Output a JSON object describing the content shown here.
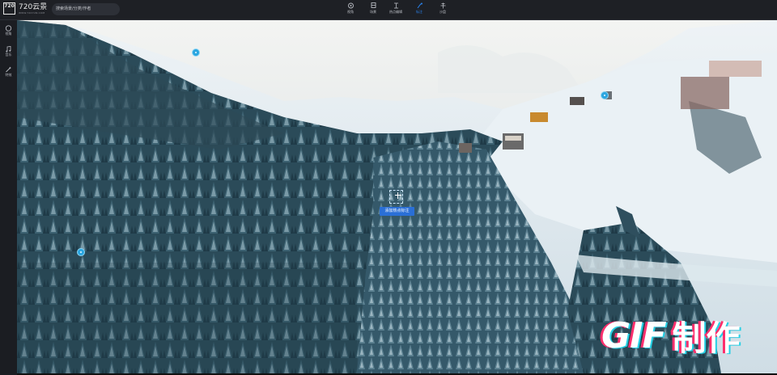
{
  "app": {
    "logo_mark": "720",
    "name": "720云景",
    "subtitle": "WWW.720YUN.COM"
  },
  "search": {
    "placeholder": "搜索场景/分类/作者"
  },
  "toolbar": {
    "items": [
      {
        "icon": "view-icon",
        "label": "视角"
      },
      {
        "icon": "scene-icon",
        "label": "场景"
      },
      {
        "icon": "hotspot-icon",
        "label": "热点编辑"
      },
      {
        "icon": "marker-icon",
        "label": "标注",
        "active": true
      },
      {
        "icon": "sandbox-icon",
        "label": "沙盘"
      }
    ]
  },
  "sidebar": {
    "items": [
      {
        "icon": "circle-icon",
        "label": "视角"
      },
      {
        "icon": "music-icon",
        "label": "音乐"
      },
      {
        "icon": "magic-wand-icon",
        "label": "特效"
      }
    ]
  },
  "viewer": {
    "add_hotspot_label": "添加热点标注"
  },
  "watermark": {
    "gif": "GIF",
    "text": "制作"
  },
  "colors": {
    "accent": "#2a83ee",
    "hotspot": "#2ba6e0",
    "button": "#2a6fd6"
  }
}
